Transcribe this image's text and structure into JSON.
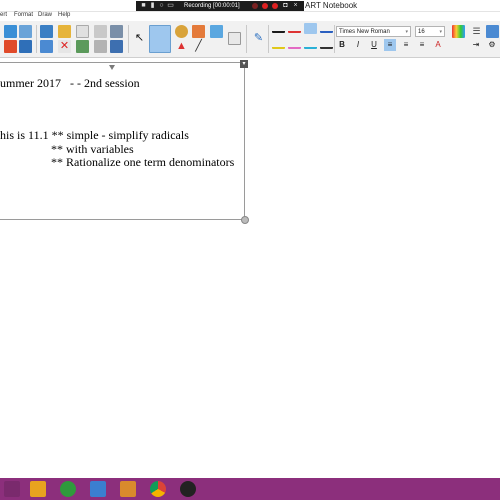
{
  "window": {
    "title": "ART Notebook"
  },
  "recorder": {
    "status": "Recording [00:00:01]"
  },
  "menu": {
    "items": [
      "ert",
      "Format",
      "Draw",
      "Help"
    ]
  },
  "format_bar": {
    "font_name": "Times New Roman",
    "font_size": "16",
    "bold": "B",
    "italic": "I",
    "underline": "U"
  },
  "note": {
    "lines": [
      "ummer 2017   - - 2nd session",
      "his is 11.1 ** simple - simplify radicals",
      "** with variables",
      "** Rationalize one term denominators"
    ]
  },
  "colors": {
    "taskbar": "#8c2f7c",
    "recorder_bar": "#1c1c1c",
    "toolbar_bg": "#f1f1f1",
    "active_tool": "#9ec7ee"
  },
  "icons": {
    "toolbar": [
      "undo-icon",
      "redo-icon",
      "delete-icon",
      "screen-shade-icon",
      "table-icon",
      "document-camera-icon",
      "select-icon",
      "pen-icon",
      "eraser-icon",
      "line-icon",
      "shape-icon",
      "fill-icon",
      "text-icon"
    ],
    "taskbar": [
      "start-button",
      "file-explorer-icon",
      "folder-icon",
      "app-icon",
      "notebook-icon",
      "chrome-icon",
      "record-app-icon"
    ]
  }
}
